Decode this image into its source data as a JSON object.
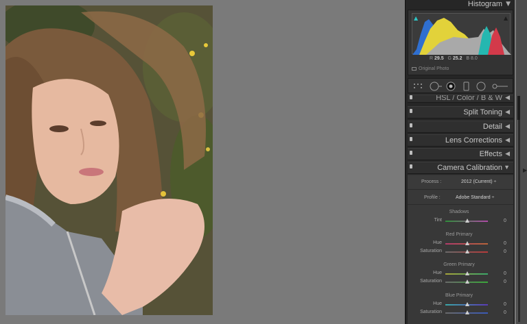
{
  "histogram": {
    "title": "Histogram",
    "r_label": "R",
    "r_value": "29.5",
    "g_label": "G",
    "g_value": "25.2",
    "b_label": "B",
    "b_value": "8.0",
    "original_photo": "Original Photo"
  },
  "panels": {
    "hsl": "HSL  /  Color  /  B & W",
    "split_toning": "Split Toning",
    "detail": "Detail",
    "lens_corrections": "Lens Corrections",
    "effects": "Effects",
    "camera_calibration": "Camera Calibration"
  },
  "calibration": {
    "process_label": "Process :",
    "process_value": "2012 (Current) ÷",
    "profile_label": "Profile :",
    "profile_value": "Adobe Standard ÷",
    "shadows_title": "Shadows",
    "tint_label": "Tint",
    "tint_value": "0",
    "red_title": "Red Primary",
    "red_hue_label": "Hue",
    "red_hue_value": "0",
    "red_sat_label": "Saturation",
    "red_sat_value": "0",
    "green_title": "Green Primary",
    "green_hue_label": "Hue",
    "green_hue_value": "0",
    "green_sat_label": "Saturation",
    "green_sat_value": "0",
    "blue_title": "Blue Primary",
    "blue_hue_label": "Hue",
    "blue_hue_value": "0",
    "blue_sat_label": "Saturation",
    "blue_sat_value": "0"
  },
  "icons": {
    "clip_shadow": "triangle-teal",
    "clip_highlight": "triangle-white",
    "collapse": "triangle-left",
    "expand": "triangle-down"
  },
  "colors": {
    "background": "#7a7a7a",
    "panel": "#262626",
    "accent_teal": "#2ec4c4"
  }
}
